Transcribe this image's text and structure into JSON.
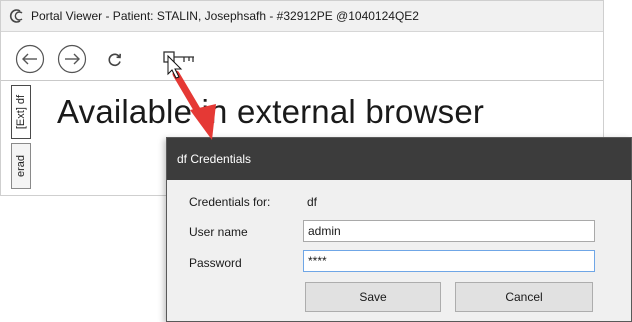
{
  "window": {
    "title": "Portal Viewer - Patient: STALIN, Josephsafh - #32912PE @1040124QE2"
  },
  "toolbar": {
    "back_icon": "back-arrow-icon",
    "forward_icon": "forward-arrow-icon",
    "refresh_icon": "refresh-icon",
    "key_icon": "key-icon"
  },
  "tabs": [
    {
      "label": "[Ext] df"
    },
    {
      "label": "erad"
    }
  ],
  "content": {
    "message": "Available in external browser"
  },
  "dialog": {
    "title": "df Credentials",
    "credentials_for_label": "Credentials for:",
    "credentials_for_value": "df",
    "username_label": "User name",
    "username_value": "admin",
    "password_label": "Password",
    "password_value": "****",
    "save_label": "Save",
    "cancel_label": "Cancel"
  },
  "colors": {
    "dialog_titlebar": "#3c3c3c",
    "annotation_arrow": "#e53935",
    "focus_border": "#6fa6e6"
  }
}
